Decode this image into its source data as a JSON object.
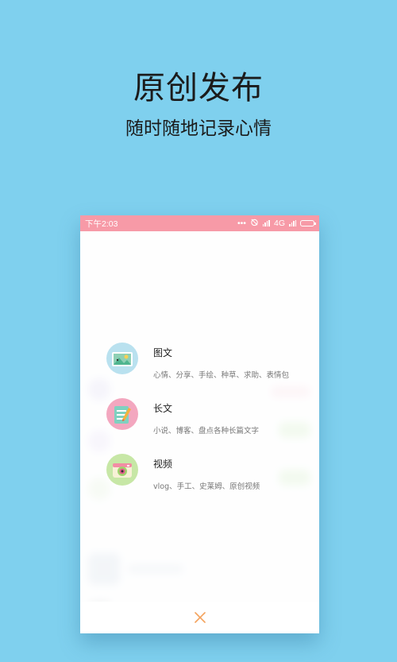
{
  "hero": {
    "title": "原创发布",
    "subtitle": "随时随地记录心情"
  },
  "statusbar": {
    "time": "下午2:03",
    "network": "4G",
    "icons": [
      "dots-icon",
      "alarm-icon",
      "signal-icon",
      "battery-icon"
    ]
  },
  "menu": {
    "items": [
      {
        "title": "图文",
        "desc": "心情、分享、手绘、种草、求助、表情包",
        "icon": "image-text-icon",
        "icon_bg": "#b9e1ef"
      },
      {
        "title": "长文",
        "desc": "小说、博客、盘点各种长篇文字",
        "icon": "long-article-icon",
        "icon_bg": "#f3a7bf"
      },
      {
        "title": "视频",
        "desc": "vlog、手工、史莱姆、原创视频",
        "icon": "video-camera-icon",
        "icon_bg": "#c7e7a6"
      }
    ]
  },
  "close_button": {
    "icon": "close-icon",
    "color": "#f4a25c"
  },
  "colors": {
    "background": "#7fd0ee",
    "statusbar": "#f79aa7"
  }
}
